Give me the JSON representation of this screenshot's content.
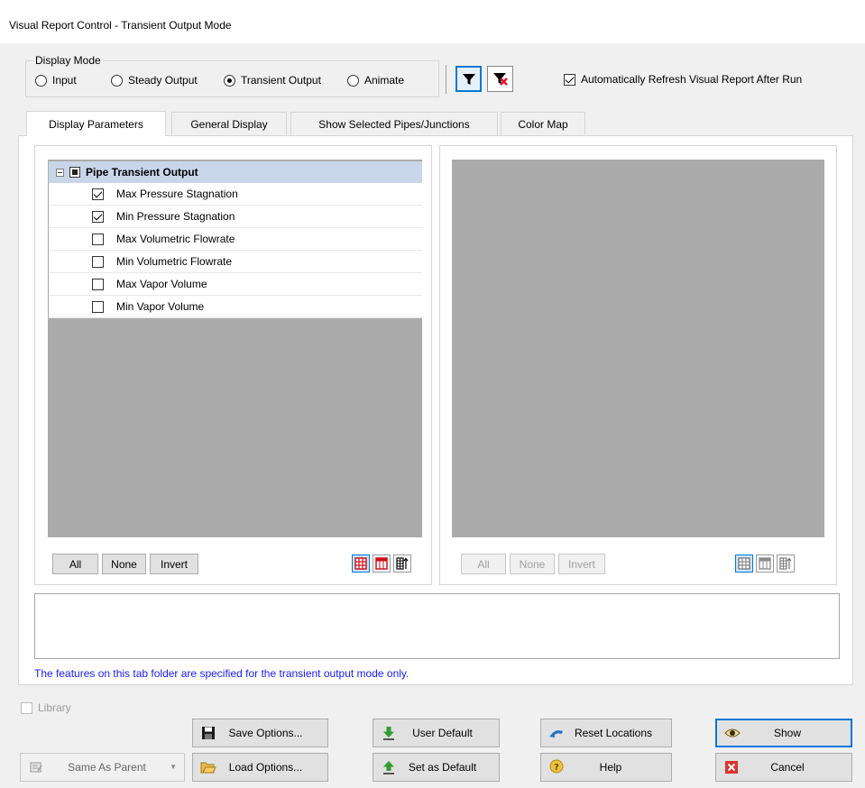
{
  "window": {
    "title": "Visual Report Control - Transient Output Mode"
  },
  "display_mode": {
    "label": "Display Mode",
    "options": [
      {
        "label": "Input",
        "selected": false
      },
      {
        "label": "Steady Output",
        "selected": false
      },
      {
        "label": "Transient Output",
        "selected": true
      },
      {
        "label": "Animate",
        "selected": false
      }
    ],
    "auto_refresh": {
      "label": "Automatically Refresh Visual Report After Run",
      "checked": true
    }
  },
  "tabs": [
    {
      "label": "Display Parameters",
      "active": true
    },
    {
      "label": "General Display",
      "active": false
    },
    {
      "label": "Show Selected Pipes/Junctions",
      "active": false
    },
    {
      "label": "Color Map",
      "active": false
    }
  ],
  "left_tree": {
    "group_label": "Pipe Transient Output",
    "items": [
      {
        "label": "Max Pressure Stagnation",
        "checked": true
      },
      {
        "label": "Min Pressure Stagnation",
        "checked": true
      },
      {
        "label": "Max Volumetric Flowrate",
        "checked": false
      },
      {
        "label": "Min Volumetric Flowrate",
        "checked": false
      },
      {
        "label": "Max Vapor Volume",
        "checked": false
      },
      {
        "label": "Min Vapor Volume",
        "checked": false
      }
    ]
  },
  "selection_buttons": {
    "all": "All",
    "none": "None",
    "invert": "Invert"
  },
  "info_note": "The features on this tab folder are specified for the transient output mode only.",
  "library": {
    "label": "Library",
    "checked": false
  },
  "bottom": {
    "same_as_parent": "Same As Parent",
    "save_options": "Save Options...",
    "load_options": "Load Options...",
    "user_default": "User Default",
    "set_as_default": "Set as Default",
    "reset_locations": "Reset Locations",
    "help": "Help",
    "show": "Show",
    "cancel": "Cancel"
  },
  "colors": {
    "accent": "#0078d7",
    "tree_header": "#c9d6ea",
    "panel_gray": "#ababab",
    "note_text": "#1a1aff"
  }
}
